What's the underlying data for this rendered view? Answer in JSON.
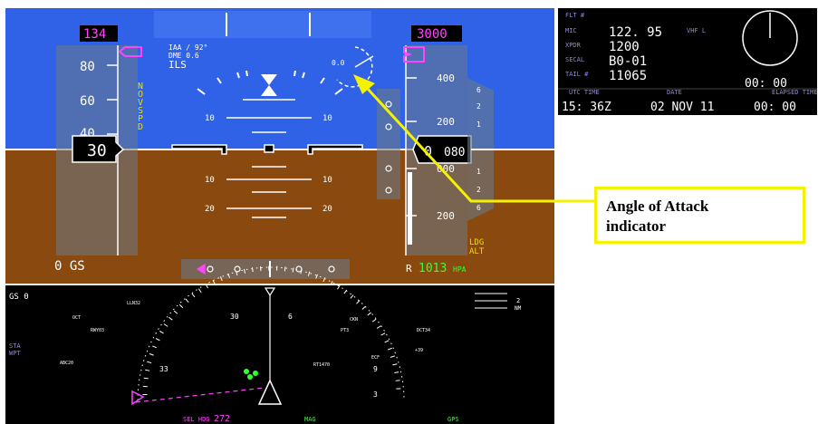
{
  "pfd": {
    "speed": {
      "selected": "134",
      "current": "30",
      "ticks": [
        "80",
        "60",
        "40"
      ],
      "ground_speed": "0 GS",
      "no_vspd_flag": "NO V SPD"
    },
    "altitude": {
      "selected": "3000",
      "current_hundreds": "0",
      "current_rolling": "080",
      "ticks": [
        "400",
        "200",
        "000",
        "200"
      ],
      "baro_prefix": "R",
      "baro_value": "1013",
      "baro_unit": "HPA",
      "ldg_alt": "LDG ALT"
    },
    "nav": {
      "line1": "IAA / 92°",
      "line2": "DME 0.6",
      "line3": "ILS"
    },
    "pitch_labels": [
      "10",
      "10",
      "10",
      "10",
      "20",
      "20"
    ],
    "aoa": {
      "value": "0.0"
    },
    "vsi_ticks": [
      "6",
      "2",
      "1",
      "1",
      "2",
      "6"
    ],
    "roll_indicator_color": "#ffffff"
  },
  "colors": {
    "sky": "#2f62e6",
    "ground": "#8a4a0f",
    "magenta": "#ff44ff",
    "green": "#33ff33",
    "yellow_callout": "#f5f200",
    "tape": "#6b7a88"
  },
  "data_panel": {
    "flt_label": "FLT #",
    "mic_label": "MIC",
    "mic_value": "122. 95",
    "mic_radio": "VHF L",
    "xpdr_label": "XPDR",
    "xpdr_value": "1200",
    "selcal_label": "SECAL",
    "selcal_value": "B0-01",
    "tail_label": "TAIL #",
    "tail_value": "11065",
    "utc_label": "UTC TIME",
    "date_label": "DATE",
    "elapsed_label": "ELAPSED TIME",
    "utc_value": "15: 36Z",
    "date_value": "02 NOV 11",
    "elapsed_value": "00: 00",
    "clock_value": "00: 00"
  },
  "nd": {
    "gs_label": "GS 0",
    "range": "2",
    "range_unit": "NM",
    "sta_label": "STA",
    "wpt_label": "WPT",
    "hdg_label": "SEL HDG",
    "hdg_value": "272",
    "mag_label": "MAG",
    "gps_label": "GPS",
    "compass_labels": [
      "33",
      "30",
      "6",
      "9",
      "3"
    ],
    "waypoints": [
      "LLN32",
      "OCT",
      "RWY03",
      "CKN",
      "ABC20",
      "DCT34",
      "ECF",
      "RT1470",
      "PT3",
      "+39"
    ]
  },
  "callout": {
    "line1": "Angle of Attack",
    "line2": "indicator"
  }
}
